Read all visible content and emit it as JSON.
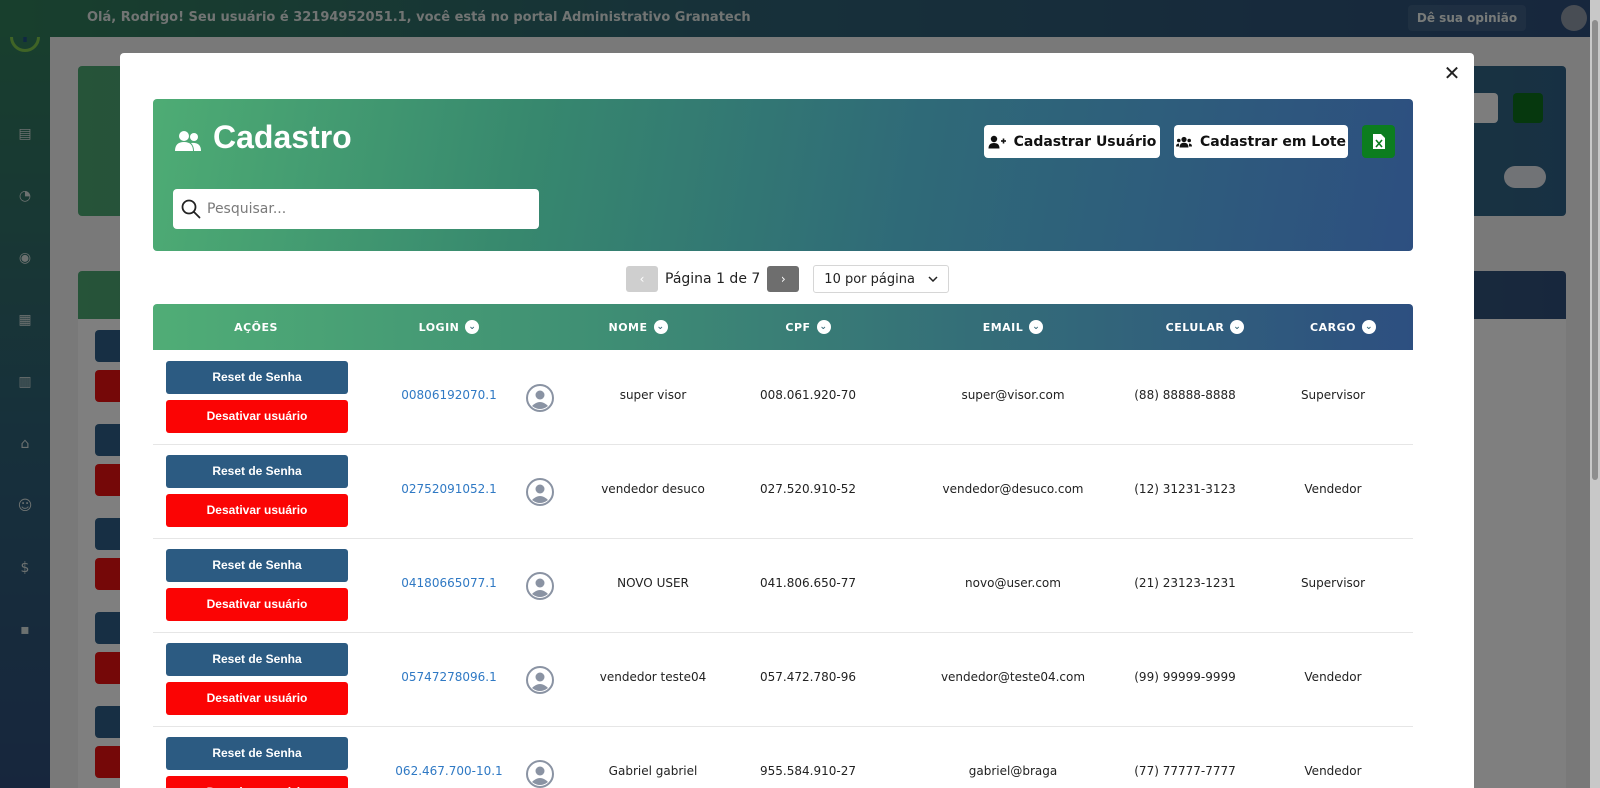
{
  "topbar": {
    "greeting": "Olá, Rodrigo! Seu usuário é 32194952051.1, você está no portal Administrativo Granatech",
    "feedback_label": "Dê sua opinião"
  },
  "modal": {
    "title": "Cadastro",
    "search_placeholder": "Pesquisar...",
    "buttons": {
      "register_user": "Cadastrar Usuário",
      "register_batch": "Cadastrar em Lote"
    },
    "pagination": {
      "prev": "‹",
      "next": "›",
      "label": "Página 1 de 7",
      "per_page": "10 por página"
    },
    "columns": {
      "actions": "AÇÕES",
      "login": "LOGIN",
      "name": "NOME",
      "cpf": "CPF",
      "email": "EMAIL",
      "phone": "CELULAR",
      "role": "CARGO"
    },
    "actions": {
      "reset": "Reset de Senha",
      "disable": "Desativar usuário"
    },
    "rows": [
      {
        "login": "00806192070.1",
        "name": "super visor",
        "cpf": "008.061.920-70",
        "email": "super@visor.com",
        "phone": "(88) 88888-8888",
        "role": "Supervisor"
      },
      {
        "login": "02752091052.1",
        "name": "vendedor desuco",
        "cpf": "027.520.910-52",
        "email": "vendedor@desuco.com",
        "phone": "(12) 31231-3123",
        "role": "Vendedor"
      },
      {
        "login": "04180665077.1",
        "name": "NOVO USER",
        "cpf": "041.806.650-77",
        "email": "novo@user.com",
        "phone": "(21) 23123-1231",
        "role": "Supervisor"
      },
      {
        "login": "05747278096.1",
        "name": "vendedor teste04",
        "cpf": "057.472.780-96",
        "email": "vendedor@teste04.com",
        "phone": "(99) 99999-9999",
        "role": "Vendedor"
      },
      {
        "login": "062.467.700-10.1",
        "name": "Gabriel gabriel",
        "cpf": "955.584.910-27",
        "email": "gabriel@braga",
        "phone": "(77) 77777-7777",
        "role": "Vendedor"
      }
    ]
  },
  "colors": {
    "brand_green": "#4eac74",
    "brand_blue": "#2d4f80",
    "reset_button": "#2c5b82",
    "disable_button": "#fb0404",
    "excel_button": "#0c7d1f",
    "link": "#2f79c4"
  },
  "icons": {
    "title": "users-icon",
    "search": "search-icon",
    "register_user": "user-plus-icon",
    "register_batch": "users-icon",
    "excel": "excel-icon",
    "close": "close-icon",
    "sort": "chevron-down-circle-icon",
    "avatar": "user-avatar-icon"
  }
}
